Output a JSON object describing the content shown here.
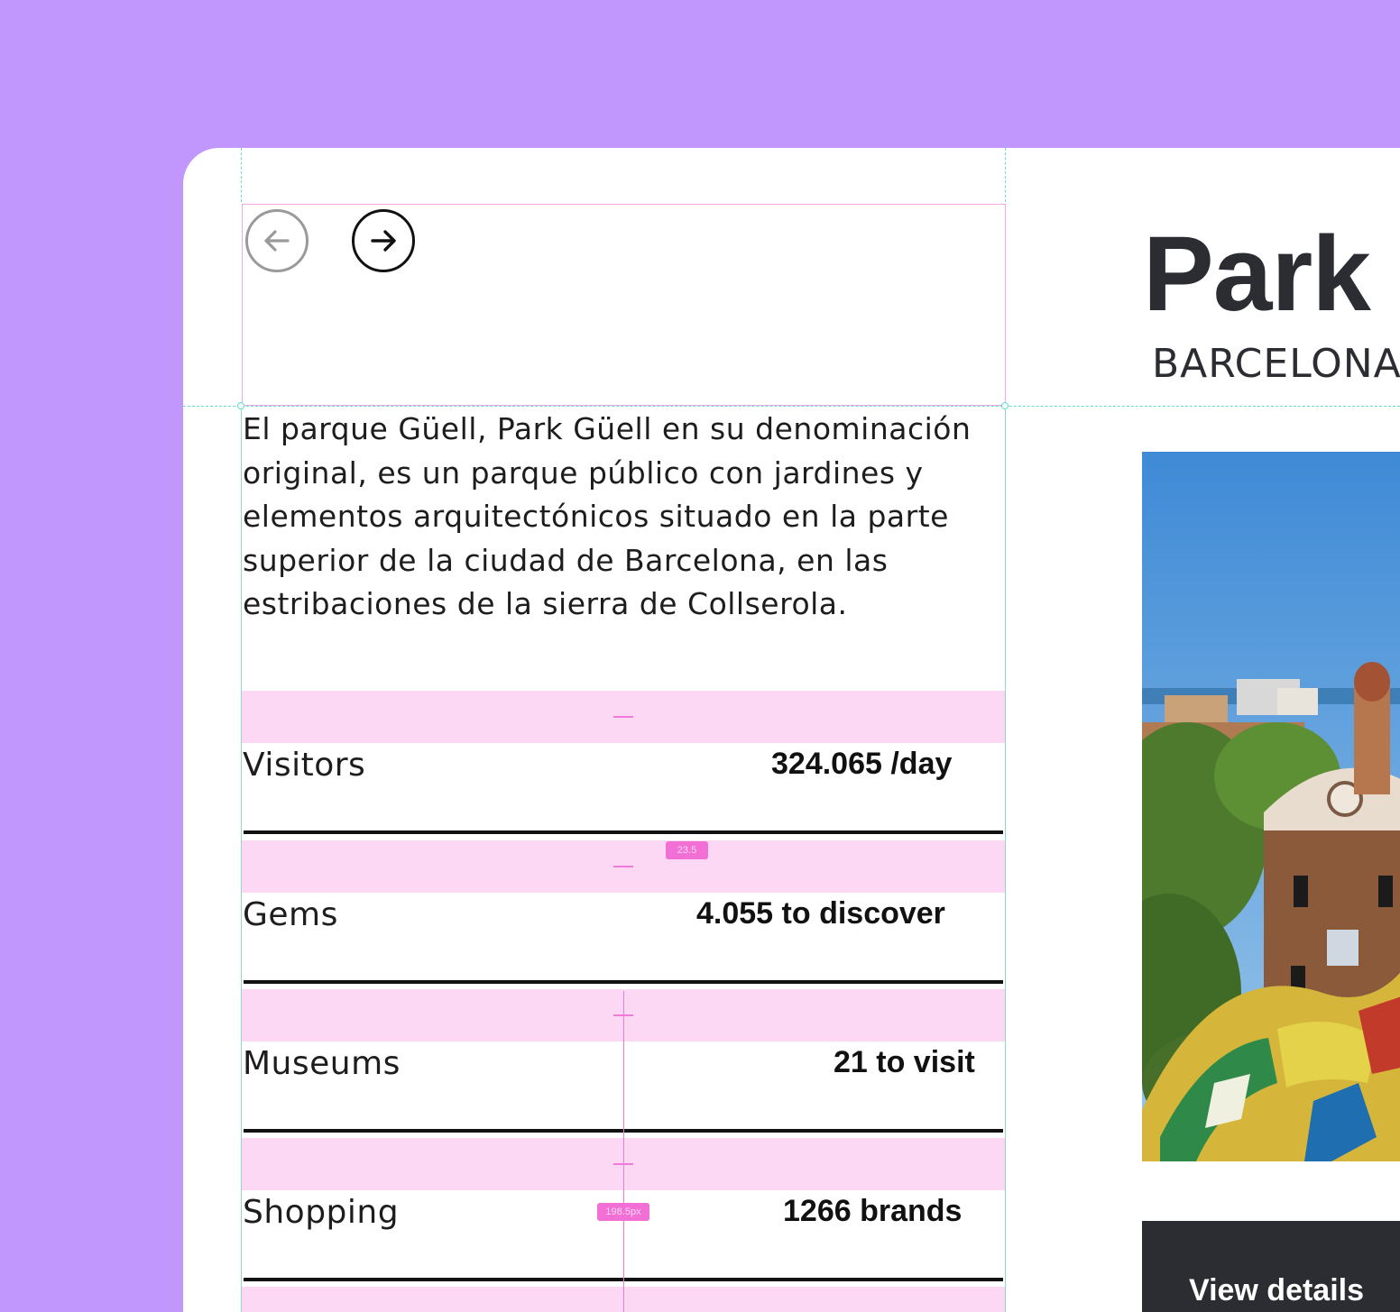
{
  "nav": {
    "prev_label": "Previous",
    "next_label": "Next"
  },
  "place": {
    "title": "Park",
    "city": "BARCELONA",
    "description": "El parque Güell, Park Güell en su denominación original, es un parque público con jardines y elementos arquitectónicos situado en la parte superior de la ciudad de Barcelona, en las estribaciones de la sierra de Collserola.",
    "cta_label": "View details"
  },
  "stats": [
    {
      "label": "Visitors",
      "value": "324.065 /day"
    },
    {
      "label": "Gems",
      "value": "4.055 to discover"
    },
    {
      "label": "Museums",
      "value": "21 to visit"
    },
    {
      "label": "Shopping",
      "value": "1266 brands"
    }
  ],
  "measurements": {
    "gap_badge": "23.5",
    "width_badge": "198.5px"
  },
  "colors": {
    "background": "#c197fd",
    "spacing_overlay": "#fdd8f5",
    "guide": "#5fe0cf",
    "button_dark": "#2b2d33"
  }
}
